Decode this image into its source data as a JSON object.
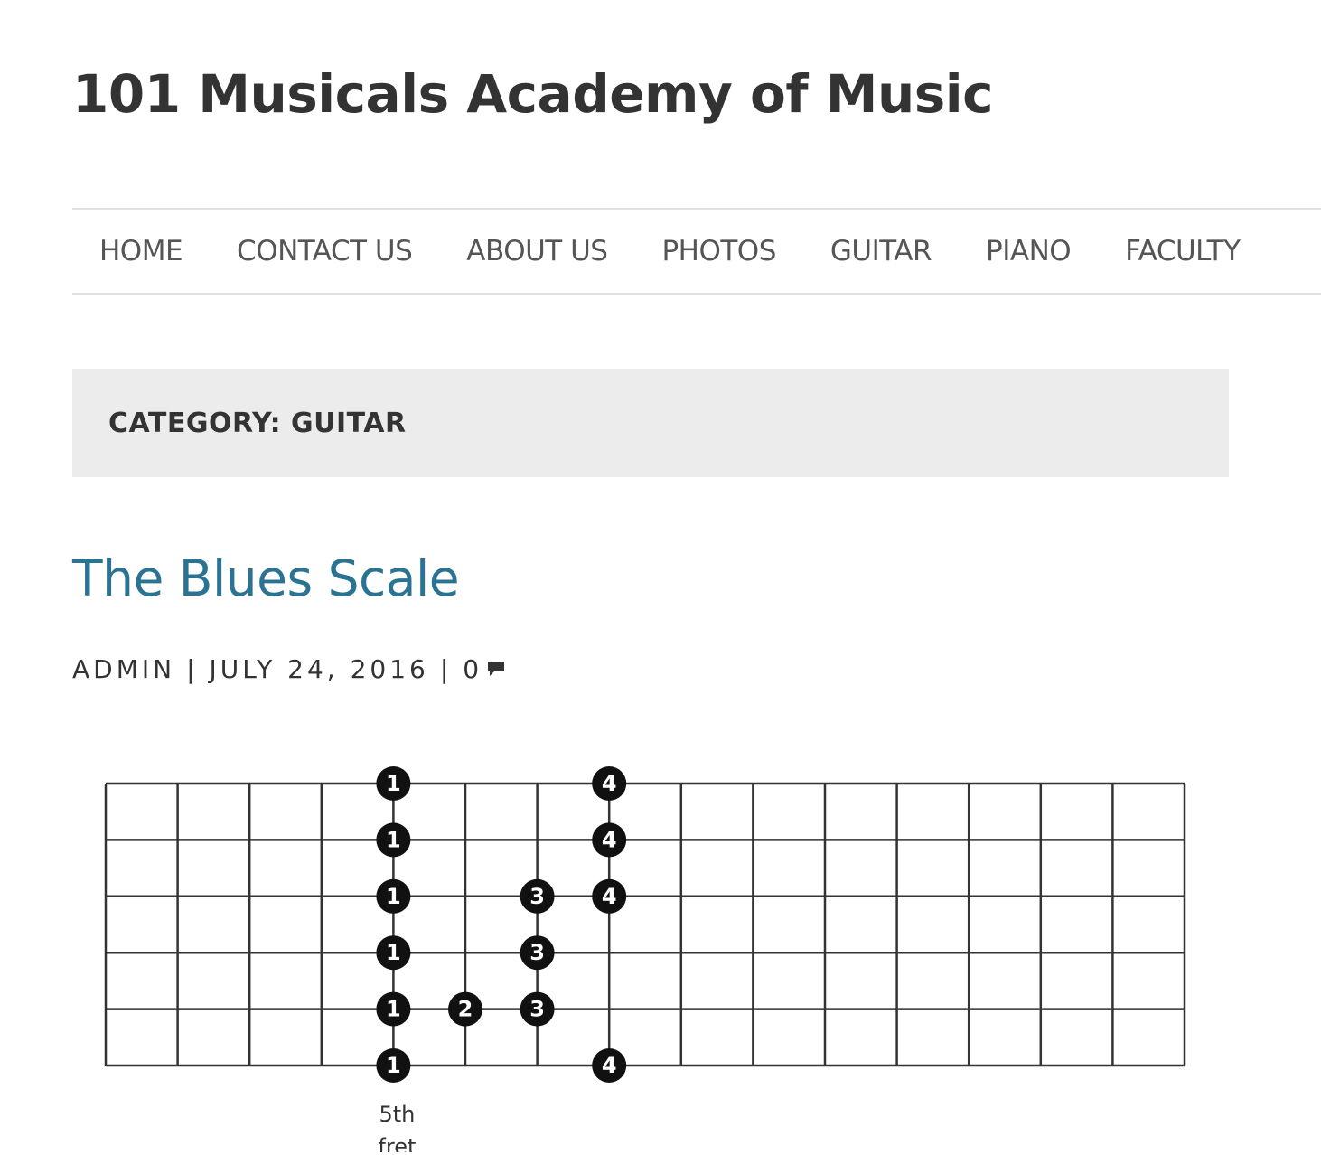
{
  "site": {
    "title": "101 Musicals Academy of Music"
  },
  "nav": {
    "items": [
      {
        "label": "HOME"
      },
      {
        "label": "CONTACT US"
      },
      {
        "label": "ABOUT US"
      },
      {
        "label": "PHOTOS"
      },
      {
        "label": "GUITAR"
      },
      {
        "label": "PIANO"
      },
      {
        "label": "FACULTY"
      }
    ]
  },
  "category": {
    "title": "CATEGORY: GUITAR"
  },
  "post": {
    "title": "The Blues Scale",
    "author": "ADMIN",
    "separator": "|",
    "date": "JULY 24, 2016",
    "comment_count": "0",
    "comment_icon": "speech-bubble-icon"
  },
  "diagram": {
    "strings": 6,
    "frets": 15,
    "notes": [
      {
        "string": 1,
        "fret": 5,
        "finger": "1"
      },
      {
        "string": 1,
        "fret": 8,
        "finger": "4"
      },
      {
        "string": 2,
        "fret": 5,
        "finger": "1"
      },
      {
        "string": 2,
        "fret": 8,
        "finger": "4"
      },
      {
        "string": 3,
        "fret": 5,
        "finger": "1"
      },
      {
        "string": 3,
        "fret": 7,
        "finger": "3"
      },
      {
        "string": 3,
        "fret": 8,
        "finger": "4"
      },
      {
        "string": 4,
        "fret": 5,
        "finger": "1"
      },
      {
        "string": 4,
        "fret": 7,
        "finger": "3"
      },
      {
        "string": 5,
        "fret": 5,
        "finger": "1"
      },
      {
        "string": 5,
        "fret": 6,
        "finger": "2"
      },
      {
        "string": 5,
        "fret": 7,
        "finger": "3"
      },
      {
        "string": 6,
        "fret": 5,
        "finger": "1"
      },
      {
        "string": 6,
        "fret": 8,
        "finger": "4"
      }
    ],
    "marker_fret": 5,
    "marker_label_line1": "5th",
    "marker_label_line2": "fret"
  }
}
